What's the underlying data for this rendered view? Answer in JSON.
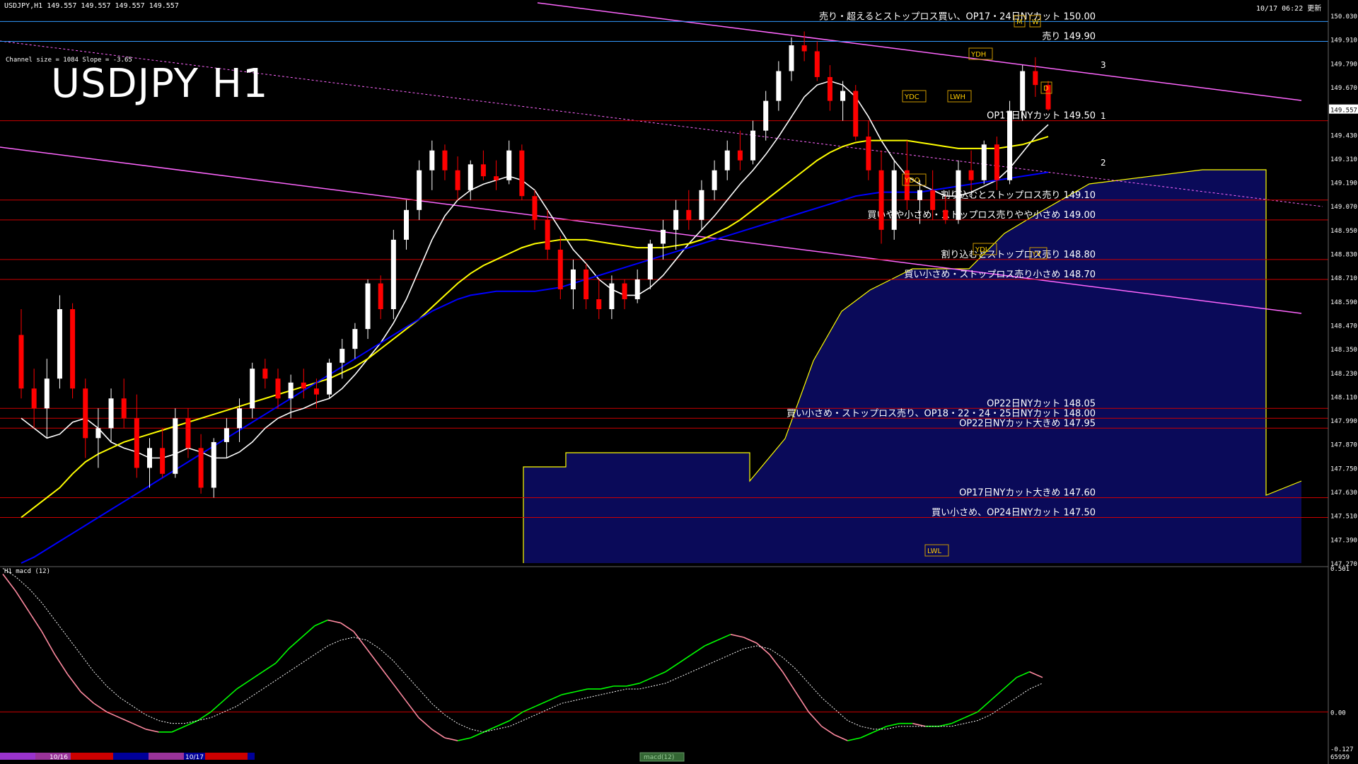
{
  "header": {
    "symbol_line": "USDJPY,H1  149.557 149.557 149.557 149.557",
    "datetime": "10/17 06:22 更新",
    "channel_info": "Channel size = 1084 Slope = -3.65",
    "big_title": "USDJPY H1"
  },
  "indicator": {
    "label": "H1  macd (12)"
  },
  "colors": {
    "background": "#000000",
    "bull_candle": "#ffffff",
    "bear_candle": "#ff0000",
    "ma_short": "#ffffff",
    "ma_mid": "#ffff00",
    "ma_long": "#0000ff",
    "cloud": "#1e1eff",
    "cloud_edge": "#ffff00",
    "channel": "#ff66ff",
    "level_line": "#cc0000",
    "annotation": "#ffffff",
    "macd": "#00ff00",
    "macd_down": "#ff8aa0",
    "signal": "#ffffff"
  },
  "chart_data": {
    "type": "candlestick",
    "title": "USDJPY H1",
    "price_axis": {
      "ylim": [
        147.27,
        150.03
      ],
      "ticks": [
        "150.030",
        "149.910",
        "149.790",
        "149.670",
        "149.557",
        "149.430",
        "149.310",
        "149.190",
        "149.070",
        "148.950",
        "148.830",
        "148.710",
        "148.590",
        "148.470",
        "148.350",
        "148.230",
        "148.110",
        "147.990",
        "147.870",
        "147.750",
        "147.630",
        "147.510",
        "147.390",
        "147.270"
      ],
      "current_price": "149.557"
    },
    "candles": [
      [
        148.42,
        148.55,
        148.1,
        148.15
      ],
      [
        148.15,
        148.25,
        147.95,
        148.05
      ],
      [
        148.05,
        148.3,
        147.9,
        148.2
      ],
      [
        148.2,
        148.62,
        148.15,
        148.55
      ],
      [
        148.55,
        148.58,
        148.1,
        148.15
      ],
      [
        148.15,
        148.2,
        147.8,
        147.9
      ],
      [
        147.9,
        148.05,
        147.75,
        147.95
      ],
      [
        147.95,
        148.15,
        147.88,
        148.1
      ],
      [
        148.1,
        148.2,
        147.95,
        148.0
      ],
      [
        148.0,
        148.12,
        147.7,
        147.75
      ],
      [
        147.75,
        147.9,
        147.65,
        147.85
      ],
      [
        147.85,
        147.95,
        147.7,
        147.72
      ],
      [
        147.72,
        148.05,
        147.7,
        148.0
      ],
      [
        148.0,
        148.05,
        147.8,
        147.85
      ],
      [
        147.85,
        147.92,
        147.62,
        147.65
      ],
      [
        147.65,
        147.9,
        147.6,
        147.88
      ],
      [
        147.88,
        148.0,
        147.8,
        147.95
      ],
      [
        147.95,
        148.1,
        147.88,
        148.05
      ],
      [
        148.05,
        148.28,
        148.0,
        148.25
      ],
      [
        148.25,
        148.3,
        148.15,
        148.2
      ],
      [
        148.2,
        148.25,
        148.05,
        148.1
      ],
      [
        148.1,
        148.22,
        148.0,
        148.18
      ],
      [
        148.18,
        148.25,
        148.1,
        148.15
      ],
      [
        148.15,
        148.2,
        148.05,
        148.12
      ],
      [
        148.12,
        148.3,
        148.1,
        148.28
      ],
      [
        148.28,
        148.4,
        148.2,
        148.35
      ],
      [
        148.35,
        148.48,
        148.3,
        148.45
      ],
      [
        148.45,
        148.7,
        148.4,
        148.68
      ],
      [
        148.68,
        148.72,
        148.5,
        148.55
      ],
      [
        148.55,
        148.95,
        148.5,
        148.9
      ],
      [
        148.9,
        149.1,
        148.85,
        149.05
      ],
      [
        149.05,
        149.3,
        149.0,
        149.25
      ],
      [
        149.25,
        149.4,
        149.15,
        149.35
      ],
      [
        149.35,
        149.38,
        149.2,
        149.25
      ],
      [
        149.25,
        149.32,
        149.1,
        149.15
      ],
      [
        149.15,
        149.3,
        149.1,
        149.28
      ],
      [
        149.28,
        149.35,
        149.2,
        149.22
      ],
      [
        149.22,
        149.3,
        149.15,
        149.2
      ],
      [
        149.2,
        149.4,
        149.18,
        149.35
      ],
      [
        149.35,
        149.38,
        149.1,
        149.12
      ],
      [
        149.12,
        149.15,
        148.95,
        149.0
      ],
      [
        149.0,
        149.05,
        148.8,
        148.85
      ],
      [
        148.85,
        148.92,
        148.6,
        148.65
      ],
      [
        148.65,
        148.8,
        148.55,
        148.75
      ],
      [
        148.75,
        148.78,
        148.55,
        148.6
      ],
      [
        148.6,
        148.7,
        148.5,
        148.55
      ],
      [
        148.55,
        148.72,
        148.5,
        148.68
      ],
      [
        148.68,
        148.7,
        148.55,
        148.6
      ],
      [
        148.6,
        148.75,
        148.58,
        148.7
      ],
      [
        148.7,
        148.9,
        148.65,
        148.88
      ],
      [
        148.88,
        149.0,
        148.8,
        148.95
      ],
      [
        148.95,
        149.1,
        148.85,
        149.05
      ],
      [
        149.05,
        149.15,
        148.95,
        149.0
      ],
      [
        149.0,
        149.2,
        148.95,
        149.15
      ],
      [
        149.15,
        149.3,
        149.1,
        149.25
      ],
      [
        149.25,
        149.4,
        149.2,
        149.35
      ],
      [
        149.35,
        149.45,
        149.25,
        149.3
      ],
      [
        149.3,
        149.5,
        149.28,
        149.45
      ],
      [
        149.45,
        149.65,
        149.4,
        149.6
      ],
      [
        149.6,
        149.8,
        149.55,
        149.75
      ],
      [
        149.75,
        149.92,
        149.7,
        149.88
      ],
      [
        149.88,
        149.95,
        149.8,
        149.85
      ],
      [
        149.85,
        149.9,
        149.7,
        149.72
      ],
      [
        149.72,
        149.78,
        149.55,
        149.6
      ],
      [
        149.6,
        149.7,
        149.5,
        149.65
      ],
      [
        149.65,
        149.68,
        149.4,
        149.42
      ],
      [
        149.42,
        149.5,
        149.2,
        149.25
      ],
      [
        149.25,
        149.35,
        148.88,
        148.95
      ],
      [
        148.95,
        149.3,
        148.9,
        149.25
      ],
      [
        149.25,
        149.4,
        149.05,
        149.1
      ],
      [
        149.1,
        149.2,
        148.98,
        149.15
      ],
      [
        149.15,
        149.25,
        149.0,
        149.05
      ],
      [
        149.05,
        149.12,
        148.98,
        149.0
      ],
      [
        149.0,
        149.3,
        148.98,
        149.25
      ],
      [
        149.25,
        149.35,
        149.15,
        149.2
      ],
      [
        149.2,
        149.4,
        149.18,
        149.38
      ],
      [
        149.38,
        149.42,
        149.15,
        149.2
      ],
      [
        149.2,
        149.6,
        149.18,
        149.55
      ],
      [
        149.55,
        149.78,
        149.5,
        149.75
      ],
      [
        149.75,
        149.82,
        149.62,
        149.68
      ],
      [
        149.68,
        149.7,
        149.55,
        149.557
      ]
    ],
    "series": [
      {
        "name": "",
        "role": "ma_short",
        "values": [
          148.0,
          147.95,
          147.9,
          147.92,
          147.98,
          148.0,
          147.95,
          147.88,
          147.85,
          147.83,
          147.8,
          147.8,
          147.82,
          147.85,
          147.83,
          147.8,
          147.8,
          147.83,
          147.88,
          147.95,
          148.0,
          148.03,
          148.05,
          148.08,
          148.1,
          148.15,
          148.22,
          148.3,
          148.38,
          148.48,
          148.6,
          148.75,
          148.9,
          149.02,
          149.1,
          149.15,
          149.18,
          149.2,
          149.22,
          149.2,
          149.15,
          149.05,
          148.95,
          148.85,
          148.78,
          148.7,
          148.65,
          148.62,
          148.62,
          148.66,
          148.72,
          148.8,
          148.88,
          148.95,
          149.02,
          149.1,
          149.18,
          149.25,
          149.33,
          149.42,
          149.52,
          149.62,
          149.68,
          149.7,
          149.68,
          149.62,
          149.52,
          149.4,
          149.3,
          149.22,
          149.18,
          149.15,
          149.12,
          149.12,
          149.14,
          149.17,
          149.2,
          149.26,
          149.34,
          149.42,
          149.48
        ]
      },
      {
        "name": "",
        "role": "ma_mid",
        "values": [
          147.5,
          147.55,
          147.6,
          147.65,
          147.72,
          147.78,
          147.82,
          147.85,
          147.88,
          147.9,
          147.92,
          147.94,
          147.96,
          147.98,
          148.0,
          148.02,
          148.04,
          148.06,
          148.08,
          148.1,
          148.12,
          148.14,
          148.16,
          148.18,
          148.2,
          148.23,
          148.26,
          148.3,
          148.35,
          148.4,
          148.45,
          148.5,
          148.56,
          148.62,
          148.68,
          148.73,
          148.77,
          148.8,
          148.83,
          148.86,
          148.88,
          148.89,
          148.9,
          148.9,
          148.9,
          148.89,
          148.88,
          148.87,
          148.86,
          148.86,
          148.86,
          148.87,
          148.88,
          148.9,
          148.93,
          148.96,
          149.0,
          149.05,
          149.1,
          149.15,
          149.2,
          149.25,
          149.3,
          149.34,
          149.37,
          149.39,
          149.4,
          149.4,
          149.4,
          149.4,
          149.39,
          149.38,
          149.37,
          149.36,
          149.36,
          149.36,
          149.36,
          149.37,
          149.38,
          149.4,
          149.42
        ]
      },
      {
        "name": "",
        "role": "ma_long",
        "values": [
          147.27,
          147.3,
          147.34,
          147.38,
          147.42,
          147.46,
          147.5,
          147.54,
          147.58,
          147.62,
          147.66,
          147.7,
          147.74,
          147.78,
          147.82,
          147.86,
          147.9,
          147.94,
          147.98,
          148.02,
          148.06,
          148.1,
          148.14,
          148.18,
          148.22,
          148.26,
          148.3,
          148.34,
          148.38,
          148.42,
          148.46,
          148.5,
          148.54,
          148.57,
          148.6,
          148.62,
          148.63,
          148.64,
          148.64,
          148.64,
          148.64,
          148.65,
          148.66,
          148.68,
          148.7,
          148.72,
          148.74,
          148.76,
          148.78,
          148.8,
          148.82,
          148.84,
          148.86,
          148.88,
          148.9,
          148.92,
          148.94,
          148.96,
          148.98,
          149.0,
          149.02,
          149.04,
          149.06,
          149.08,
          149.1,
          149.12,
          149.13,
          149.14,
          149.14,
          149.14,
          149.14,
          149.15,
          149.16,
          149.17,
          149.18,
          149.19,
          149.2,
          149.21,
          149.22,
          149.23,
          149.24
        ]
      }
    ],
    "levels": [
      {
        "price": 150.0,
        "label": "売り・超えるとストップロス買い、OP17・24日NYカット 150.00",
        "color": "#3399ff"
      },
      {
        "price": 149.9,
        "label": "売り 149.90",
        "color": "#3399ff"
      },
      {
        "price": 149.5,
        "label": "OP17日NYカット 149.50",
        "color": "#cc0000"
      },
      {
        "price": 149.1,
        "label": "割り込むとストップロス売り 149.10",
        "color": "#cc0000"
      },
      {
        "price": 149.0,
        "label": "買いやや小さめ・ストップロス売りやや小さめ 149.00",
        "color": "#cc0000"
      },
      {
        "price": 148.8,
        "label": "割り込むとストップロス売り 148.80",
        "color": "#cc0000"
      },
      {
        "price": 148.7,
        "label": "買い小さめ・ストップロス売り小さめ 148.70",
        "color": "#cc0000"
      },
      {
        "price": 148.05,
        "label": "OP22日NYカット 148.05",
        "color": "#cc0000"
      },
      {
        "price": 148.0,
        "label": "買い小さめ・ストップロス売り、OP18・22・24・25日NYカット 148.00",
        "color": "#cc0000"
      },
      {
        "price": 147.95,
        "label": "OP22日NYカット大きめ 147.95",
        "color": "#cc0000"
      },
      {
        "price": 147.6,
        "label": "OP17日NYカット大きめ 147.60",
        "color": "#cc0000"
      },
      {
        "price": 147.5,
        "label": "買い小さめ、OP24日NYカット 147.50",
        "color": "#cc0000"
      }
    ],
    "markers": [
      "YDC",
      "LWH",
      "YDO",
      "YDL",
      "LWL",
      "YDH",
      "M",
      "W",
      "D",
      "YV"
    ],
    "channel_labels": [
      "3",
      "1",
      "2"
    ],
    "macd": {
      "ylim": [
        -0.127,
        0.501
      ],
      "ticks": [
        "0.501",
        "0.00",
        "-0.127"
      ],
      "values": [
        0.48,
        0.42,
        0.35,
        0.28,
        0.2,
        0.13,
        0.07,
        0.03,
        0.0,
        -0.02,
        -0.04,
        -0.06,
        -0.07,
        -0.07,
        -0.05,
        -0.03,
        0.0,
        0.04,
        0.08,
        0.11,
        0.14,
        0.17,
        0.22,
        0.26,
        0.3,
        0.32,
        0.31,
        0.28,
        0.22,
        0.16,
        0.1,
        0.04,
        -0.02,
        -0.06,
        -0.09,
        -0.1,
        -0.09,
        -0.07,
        -0.05,
        -0.03,
        0.0,
        0.02,
        0.04,
        0.06,
        0.07,
        0.08,
        0.08,
        0.09,
        0.09,
        0.1,
        0.12,
        0.14,
        0.17,
        0.2,
        0.23,
        0.25,
        0.27,
        0.26,
        0.24,
        0.2,
        0.14,
        0.07,
        0.0,
        -0.05,
        -0.08,
        -0.1,
        -0.09,
        -0.07,
        -0.05,
        -0.04,
        -0.04,
        -0.05,
        -0.05,
        -0.04,
        -0.02,
        0.0,
        0.04,
        0.08,
        0.12,
        0.14,
        0.12
      ],
      "signal": [
        0.5,
        0.47,
        0.43,
        0.38,
        0.32,
        0.26,
        0.2,
        0.14,
        0.09,
        0.05,
        0.02,
        -0.01,
        -0.03,
        -0.04,
        -0.04,
        -0.03,
        -0.02,
        0.0,
        0.02,
        0.05,
        0.08,
        0.11,
        0.14,
        0.17,
        0.2,
        0.23,
        0.25,
        0.26,
        0.25,
        0.22,
        0.18,
        0.13,
        0.08,
        0.03,
        -0.01,
        -0.04,
        -0.06,
        -0.07,
        -0.06,
        -0.05,
        -0.03,
        -0.01,
        0.01,
        0.03,
        0.04,
        0.05,
        0.06,
        0.07,
        0.08,
        0.08,
        0.09,
        0.1,
        0.12,
        0.14,
        0.16,
        0.18,
        0.2,
        0.22,
        0.23,
        0.22,
        0.19,
        0.15,
        0.1,
        0.05,
        0.01,
        -0.03,
        -0.05,
        -0.06,
        -0.06,
        -0.05,
        -0.05,
        -0.05,
        -0.05,
        -0.05,
        -0.04,
        -0.03,
        -0.01,
        0.02,
        0.05,
        0.08,
        0.1
      ]
    },
    "date_labels": [
      "10/16",
      "10/17"
    ],
    "bottom_label": "macd(12)",
    "bottom_code": "65959",
    "grid": false
  }
}
